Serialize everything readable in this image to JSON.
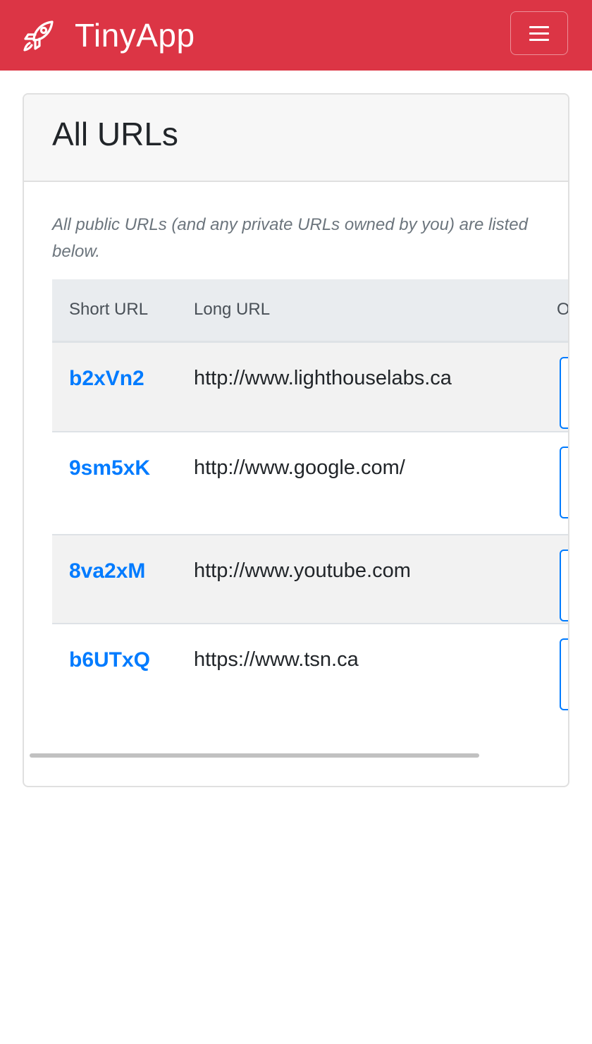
{
  "navbar": {
    "brand_name": "TinyApp",
    "brand_icon": "rocket-icon",
    "menu_icon": "hamburger-menu-icon",
    "color": "#dc3545"
  },
  "card": {
    "title": "All URLs",
    "intro": "All public URLs (and any private URLs owned by you) are listed below."
  },
  "table": {
    "headers": [
      "Short URL",
      "Long URL",
      "O"
    ],
    "rows": [
      {
        "short": "b2xVn2",
        "long": "http://www.lighthouselabs.ca"
      },
      {
        "short": "9sm5xK",
        "long": "http://www.google.com/"
      },
      {
        "short": "8va2xM",
        "long": "http://www.youtube.com"
      },
      {
        "short": "b6UTxQ",
        "long": "https://www.tsn.ca"
      }
    ]
  },
  "colors": {
    "link": "#007bff",
    "header_bg": "#e9ecef",
    "stripe": "#f2f2f2"
  }
}
